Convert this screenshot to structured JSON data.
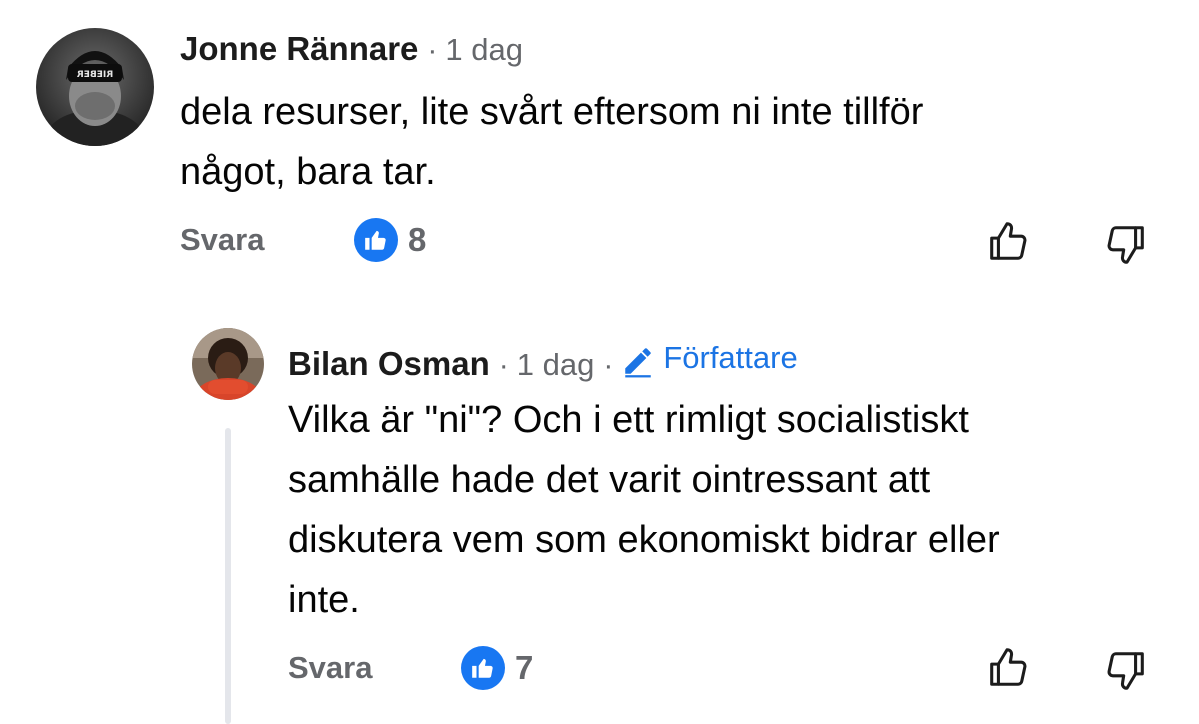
{
  "comments": [
    {
      "author": "Jonne Rännare",
      "time": "1 dag",
      "text_lines": [
        "dela resurser, lite svårt eftersom ni inte tillför",
        "något, bara tar."
      ],
      "reply_label": "Svara",
      "like_count": "8",
      "avatar_cap_text": "RIEBER"
    },
    {
      "author": "Bilan Osman",
      "time": "1 dag",
      "badge": "Författare",
      "text_lines": [
        "Vilka är \"ni\"? Och i ett rimligt socialistiskt",
        "samhälle hade det varit ointressant att",
        "diskutera vem som ekonomiskt bidrar eller",
        "inte."
      ],
      "reply_label": "Svara",
      "like_count": "7"
    }
  ],
  "colors": {
    "like_blue": "#1877f2",
    "author_badge_blue": "#1b74e4",
    "meta_gray": "#65676b"
  },
  "icons": {
    "like_reaction": "thumbs-up-icon",
    "upvote": "thumbs-up-outline-icon",
    "downvote": "thumbs-down-outline-icon",
    "author_badge": "pencil-icon"
  }
}
